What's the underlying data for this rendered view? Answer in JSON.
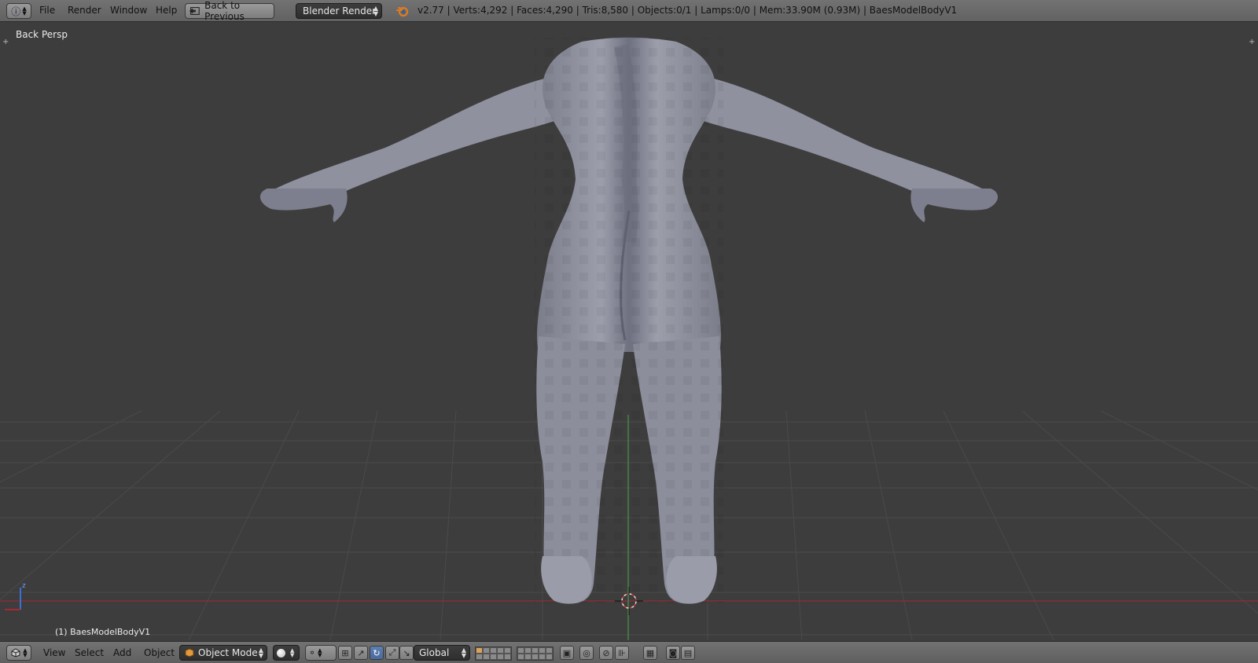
{
  "top_bar": {
    "menus": [
      "File",
      "Render",
      "Window",
      "Help"
    ],
    "back_button_label": "Back to Previous",
    "render_engine": "Blender Render",
    "stats": "v2.77 | Verts:4,292 | Faces:4,290 | Tris:8,580 | Objects:0/1 | Lamps:0/0 | Mem:33.90M (0.93M) | BaesModelBodyV1"
  },
  "viewport": {
    "view_label": "Back Persp",
    "object_label": "(1) BaesModelBodyV1",
    "axis_label": "z"
  },
  "bottom_bar": {
    "menus": [
      "View",
      "Select",
      "Add",
      "Object"
    ],
    "mode": "Object Mode",
    "orientation": "Global"
  },
  "colors": {
    "header_bg": "#6a6a6a",
    "viewport_bg": "#3d3d3d",
    "grid_line": "#4a4a4a",
    "x_axis": "#a8292f",
    "y_axis": "#4ea34e",
    "mesh": "#8a8c9c",
    "active_button": "#5d7fb3"
  },
  "icons": [
    "info-icon",
    "back-icon",
    "blender-logo-icon",
    "3d-view-icon",
    "cube-icon",
    "sphere-shading-icon",
    "pivot-icon",
    "manipulator-icon",
    "translate-icon",
    "rotate-icon",
    "scale-icon",
    "layers-icon",
    "lock-icon",
    "render-icon",
    "camera-icon"
  ]
}
